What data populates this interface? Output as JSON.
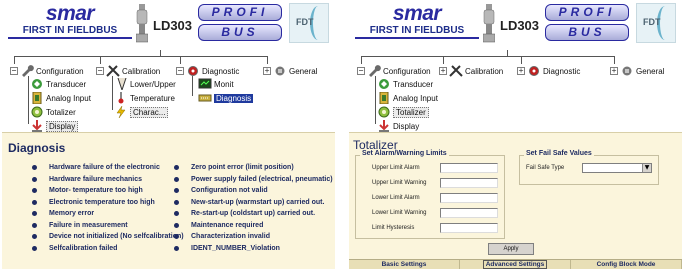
{
  "header": {
    "brand": "smar",
    "tagline": "FIRST IN FIELDBUS",
    "model": "LD303",
    "profi_top": "PROFI",
    "profi_bottom": "BUS",
    "fdt": "FDT"
  },
  "left_tree": {
    "roots": [
      {
        "label": "Configuration",
        "expander": "−"
      },
      {
        "label": "Calibration",
        "expander": "−"
      },
      {
        "label": "Diagnostic",
        "expander": "−"
      },
      {
        "label": "General",
        "expander": "+"
      }
    ],
    "configuration_children": [
      "Transducer",
      "Analog Input",
      "Totalizer",
      "Display"
    ],
    "calibration_children": [
      "Lower/Upper",
      "Temperature",
      "Charac..."
    ],
    "diagnostic_children": [
      "Monit",
      "Diagnosis"
    ]
  },
  "right_tree": {
    "roots": [
      {
        "label": "Configuration",
        "expander": "−"
      },
      {
        "label": "Calibration",
        "expander": "+"
      },
      {
        "label": "Diagnostic",
        "expander": "+"
      },
      {
        "label": "General",
        "expander": "+"
      }
    ],
    "configuration_children": [
      "Transducer",
      "Analog Input",
      "Totalizer",
      "Display"
    ]
  },
  "diagnosis": {
    "title": "Diagnosis",
    "left_items": [
      "Hardware failure of the electronic",
      "Hardware failure  mechanics",
      "Motor- temperature too high",
      "Electronic temperature too high",
      "Memory error",
      "Failure in measurement",
      "Device not initialized (No selfcalibration)",
      "Selfcalibration failed"
    ],
    "right_items": [
      "Zero point error (limit position)",
      "Power supply failed (electrical, pneumatic)",
      "Configuration not valid",
      "New-start-up (warmstart up) carried out.",
      "Re-start-up (coldstart up) carried out.",
      "Maintenance required",
      "Characterization invalid",
      "IDENT_NUMBER_Violation"
    ]
  },
  "totalizer": {
    "title": "Totalizer",
    "alarm_group": "Set Alarm/Warning Limits",
    "fields": [
      {
        "label": "Upper Limit Alarm",
        "value": ""
      },
      {
        "label": "Upper Limit Warning",
        "value": ""
      },
      {
        "label": "Lower Limit Alarm",
        "value": ""
      },
      {
        "label": "Lower Limit Warning",
        "value": ""
      },
      {
        "label": "Limit Hysteresis",
        "value": ""
      }
    ],
    "failsafe_group": "Set Fail Safe Values",
    "failsafe_label": "Fail Safe Type",
    "failsafe_value": "",
    "dropdown_arrow": "▼",
    "apply_label": "Apply",
    "tabs": [
      "Basic Settings",
      "Advanced  Settings",
      "Config Block Mode"
    ]
  }
}
